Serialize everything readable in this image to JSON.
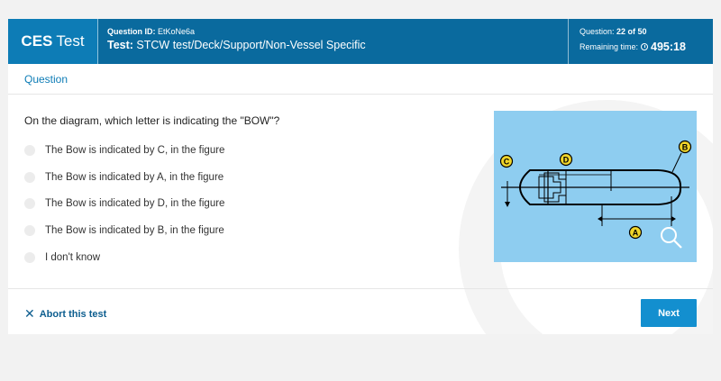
{
  "header": {
    "brand_bold": "CES",
    "brand_rest": "Test",
    "question_id_label": "Question ID:",
    "question_id": "EtKoNe6a",
    "test_label": "Test:",
    "test_path": "STCW test/Deck/Support/Non-Vessel Specific",
    "question_label": "Question:",
    "question_progress": "22 of 50",
    "remaining_label": "Remaining time:",
    "remaining_time": "495:18"
  },
  "section_label": "Question",
  "question_text": "On the diagram, which letter is indicating the \"BOW\"?",
  "options": [
    {
      "label": "The Bow is indicated by C, in the figure"
    },
    {
      "label": "The Bow is indicated by A, in the figure"
    },
    {
      "label": "The Bow is indicated by D, in the figure"
    },
    {
      "label": "The Bow is indicated by B, in the figure"
    },
    {
      "label": "I don't know"
    }
  ],
  "diagram": {
    "labels": [
      "A",
      "B",
      "C",
      "D"
    ],
    "background_color": "#8ecdf0",
    "icon": "zoom-icon"
  },
  "footer": {
    "abort_label": "Abort this test",
    "next_label": "Next"
  },
  "colors": {
    "header_bg": "#0a6a9e",
    "brand_bg": "#0d7cb6",
    "accent": "#138fcf"
  }
}
